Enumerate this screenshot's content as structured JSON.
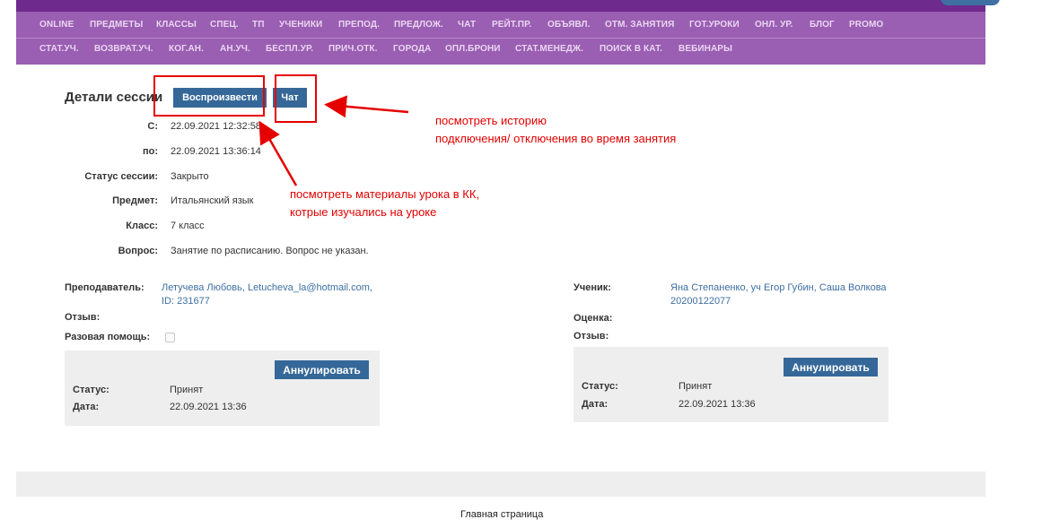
{
  "nav": {
    "row1": [
      "ONLINE",
      "ПРЕДМЕТЫ",
      "КЛАССЫ",
      "СПЕЦ.",
      "ТП",
      "УЧЕНИКИ",
      "ПРЕПОД.",
      "ПРЕДЛОЖ.",
      "ЧАТ",
      "РЕЙТ.ПР.",
      "ОБЪЯВЛ.",
      "ОТМ. ЗАНЯТИЯ",
      "ГОТ.УРОКИ",
      "ОНЛ. УР.",
      "БЛОГ",
      "PROMO"
    ],
    "row2": [
      "СТАТ.УЧ.",
      "ВОЗВРАТ.УЧ.",
      "КОГ.АН.",
      "АН.УЧ.",
      "БЕСПЛ.УР.",
      "ПРИЧ.ОТК.",
      "ГОРОДА",
      "ОПЛ.БРОНИ",
      "СТАТ.МЕНЕДЖ.",
      "ПОИСК В КАТ.",
      "ВЕБИНАРЫ"
    ]
  },
  "session": {
    "title": "Детали сессии",
    "play_button": "Воспроизвести",
    "chat_button": "Чат",
    "fields": [
      {
        "label": "С:",
        "value": "22.09.2021 12:32:58"
      },
      {
        "label": "по:",
        "value": "22.09.2021 13:36:14"
      },
      {
        "label": "Статус сессии:",
        "value": "Закрыто"
      },
      {
        "label": "Предмет:",
        "value": "Итальянский язык"
      },
      {
        "label": "Класс:",
        "value": "7 класс"
      },
      {
        "label": "Вопрос:",
        "value": "Занятие по расписанию. Вопрос не указан."
      }
    ]
  },
  "teacher": {
    "label": "Преподаватель:",
    "name_line1": "Летучева Любовь, Letucheva_la@hotmail.com,",
    "name_line2": "ID: 231677",
    "review_label": "Отзыв:",
    "help_label": "Разовая помощь:",
    "help_checked": false,
    "cancel_button": "Аннулировать",
    "status_label": "Статус:",
    "status_value": "Принят",
    "date_label": "Дата:",
    "date_value": "22.09.2021 13:36"
  },
  "student": {
    "label": "Ученик:",
    "name_line1": "Яна Степаненко, уч Егор Губин, Саша Волкова",
    "name_line2": "20200122077",
    "rating_label": "Оценка:",
    "review_label": "Отзыв:",
    "cancel_button": "Аннулировать",
    "status_label": "Статус:",
    "status_value": "Принят",
    "date_label": "Дата:",
    "date_value": "22.09.2021 13:36"
  },
  "annotations": {
    "chat_note_line1": "посмотреть историю",
    "chat_note_line2": "подключения/  отключения во время занятия",
    "play_note_line1": "посмотреть материалы урока в КК,",
    "play_note_line2": "котрые изучались на уроке"
  },
  "footer": {
    "home_link": "Главная страница"
  },
  "colors": {
    "nav_dark": "#6e2a8c",
    "nav_light": "#9a5eb2",
    "button_blue": "#356898",
    "link_blue": "#3d6fa3",
    "annotation_red": "#e10000"
  }
}
